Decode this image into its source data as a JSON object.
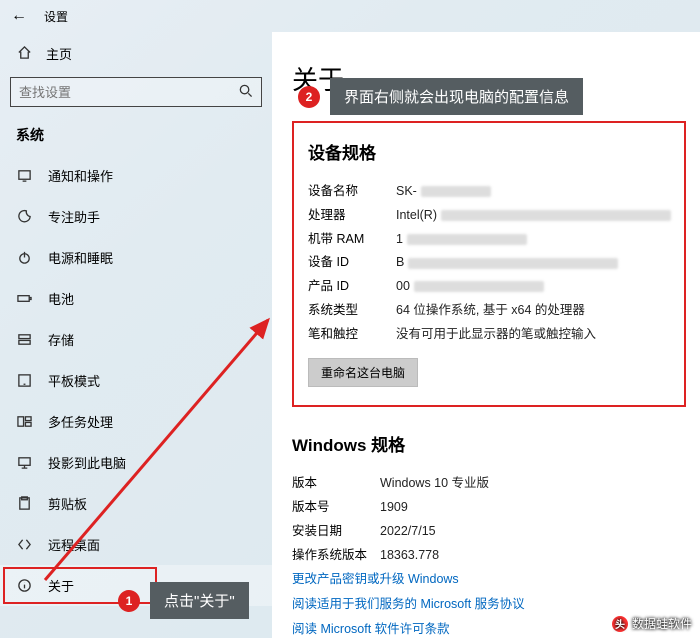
{
  "titlebar": {
    "title": "设置"
  },
  "sidebar": {
    "home": "主页",
    "search_placeholder": "查找设置",
    "section": "系统",
    "items": [
      {
        "label": "通知和操作"
      },
      {
        "label": "专注助手"
      },
      {
        "label": "电源和睡眠"
      },
      {
        "label": "电池"
      },
      {
        "label": "存储"
      },
      {
        "label": "平板模式"
      },
      {
        "label": "多任务处理"
      },
      {
        "label": "投影到此电脑"
      },
      {
        "label": "剪贴板"
      },
      {
        "label": "远程桌面"
      },
      {
        "label": "关于"
      }
    ]
  },
  "content": {
    "heading": "关于",
    "device_spec_title": "设备规格",
    "device": [
      {
        "k": "设备名称",
        "v": "SK-"
      },
      {
        "k": "处理器",
        "v": "Intel(R)"
      },
      {
        "k": "机带 RAM",
        "v": "1"
      },
      {
        "k": "设备 ID",
        "v": "B"
      },
      {
        "k": "产品 ID",
        "v": "00"
      },
      {
        "k": "系统类型",
        "v": "64 位操作系统, 基于 x64 的处理器"
      },
      {
        "k": "笔和触控",
        "v": "没有可用于此显示器的笔或触控输入"
      }
    ],
    "rename": "重命名这台电脑",
    "win_spec_title": "Windows 规格",
    "win": [
      {
        "k": "版本",
        "v": "Windows 10 专业版"
      },
      {
        "k": "版本号",
        "v": "1909"
      },
      {
        "k": "安装日期",
        "v": "2022/7/15"
      },
      {
        "k": "操作系统版本",
        "v": "18363.778"
      }
    ],
    "links": {
      "l1": "更改产品密钥或升级 Windows",
      "l2": "阅读适用于我们服务的 Microsoft 服务协议",
      "l3": "阅读 Microsoft 软件许可条款"
    }
  },
  "annotations": {
    "step1_num": "1",
    "step1_text": "点击\"关于\"",
    "step2_num": "2",
    "step2_text": "界面右侧就会出现电脑的配置信息"
  },
  "watermark": "数据蛙软件"
}
